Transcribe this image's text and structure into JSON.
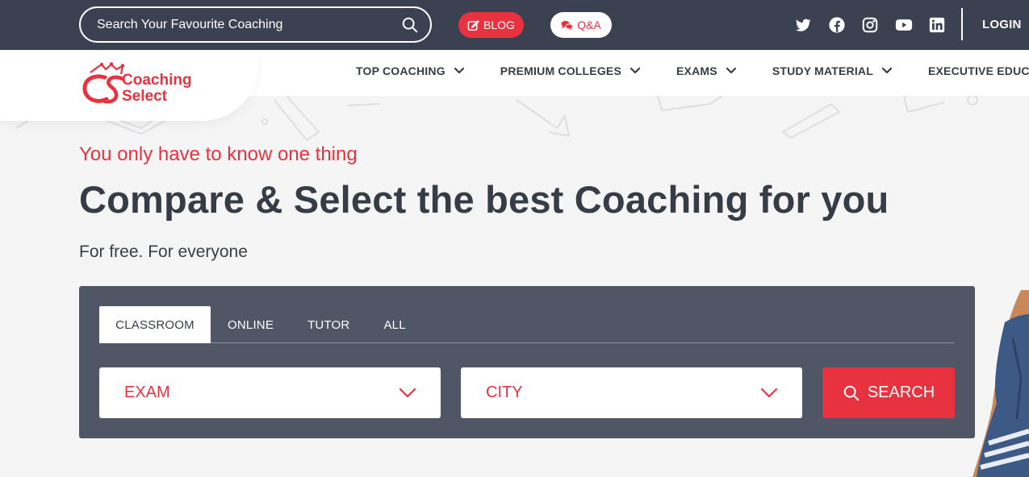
{
  "topbar": {
    "search_placeholder": "Search Your Favourite Coaching",
    "blog_label": "BLOG",
    "qa_label": "Q&A",
    "social_icons": [
      "twitter-icon",
      "facebook-icon",
      "instagram-icon",
      "youtube-icon",
      "linkedin-icon"
    ],
    "login_label": "LOGIN"
  },
  "brand": {
    "line1": "Coaching",
    "line2": "Select",
    "logo_monogram": "CS"
  },
  "nav": {
    "items": [
      {
        "label": "TOP COACHING"
      },
      {
        "label": "PREMIUM COLLEGES"
      },
      {
        "label": "EXAMS"
      },
      {
        "label": "STUDY MATERIAL"
      },
      {
        "label": "EXECUTIVE EDUCATI"
      }
    ]
  },
  "hero": {
    "tagline": "You only have to know one thing",
    "headline": "Compare & Select the best Coaching for you",
    "subline": "For free. For everyone"
  },
  "search_panel": {
    "tabs": [
      {
        "label": "CLASSROOM",
        "active": true
      },
      {
        "label": "ONLINE",
        "active": false
      },
      {
        "label": "TUTOR",
        "active": false
      },
      {
        "label": "ALL",
        "active": false
      }
    ],
    "exam_select": "EXAM",
    "city_select": "CITY",
    "search_button": "SEARCH"
  },
  "colors": {
    "topbar_bg": "#3a4150",
    "accent": "#e8323f",
    "panel_bg": "#4f5665",
    "text_dark": "#363d47"
  }
}
